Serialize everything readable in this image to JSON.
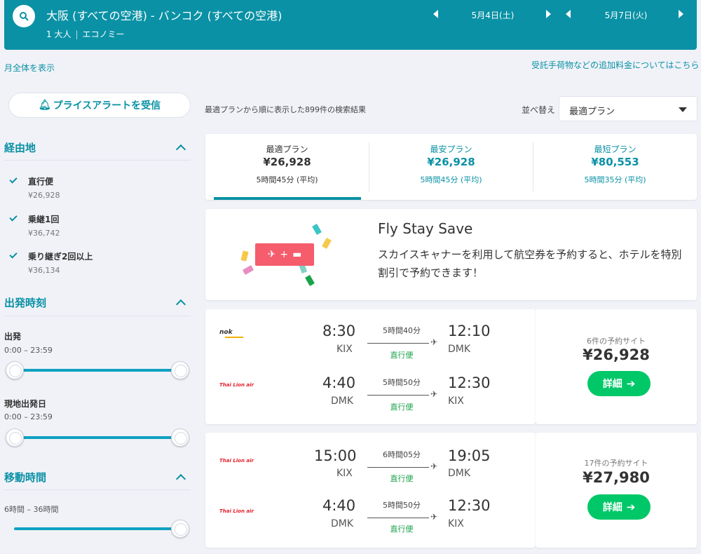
{
  "header": {
    "route": "大阪 (すべての空港) - バンコク (すべての空港)",
    "passengers": "1 大人",
    "cabin": "エコノミー",
    "depart_date": "5月4日(土)",
    "return_date": "5月7日(火)"
  },
  "links": {
    "show_month": "月全体を表示",
    "extra_fees": "受託手荷物などの追加料金についてはこちら"
  },
  "sidebar": {
    "price_alert": "プライスアラートを受信",
    "stops": {
      "title": "経由地",
      "options": [
        {
          "label": "直行便",
          "price": "¥26,928"
        },
        {
          "label": "乗継1回",
          "price": "¥36,742"
        },
        {
          "label": "乗り継ぎ2回以上",
          "price": "¥36,134"
        }
      ]
    },
    "departure_time": {
      "title": "出発時刻",
      "outbound_label": "出発",
      "outbound_range": "0:00 – 23:59",
      "return_label": "現地出発日",
      "return_range": "0:00 – 23:59"
    },
    "duration": {
      "title": "移動時間",
      "range": "6時間 – 36時間"
    }
  },
  "results": {
    "count_text": "最適プランから順に表示した899件の検索結果",
    "sort_label": "並べ替え",
    "sort_value": "最適プラン"
  },
  "tabs": [
    {
      "label": "最適プラン",
      "price": "¥26,928",
      "duration": "5時間45分 (平均)"
    },
    {
      "label": "最安プラン",
      "price": "¥26,928",
      "duration": "5時間45分 (平均)"
    },
    {
      "label": "最短プラン",
      "price": "¥80,553",
      "duration": "5時間35分 (平均)"
    }
  ],
  "promo": {
    "title": "Fly Stay Save",
    "text": "スカイスキャナーを利用して航空券を予約すると、ホテルを特別割引で予約できます！"
  },
  "flights": [
    {
      "legs": [
        {
          "airline": "nok",
          "dep_time": "8:30",
          "dep_ap": "KIX",
          "duration": "5時間40分",
          "stops": "直行便",
          "arr_time": "12:10",
          "arr_ap": "DMK"
        },
        {
          "airline": "Thai Lion air",
          "dep_time": "4:40",
          "dep_ap": "DMK",
          "duration": "5時間50分",
          "stops": "直行便",
          "arr_time": "12:30",
          "arr_ap": "KIX"
        }
      ],
      "sites": "6件の予約サイト",
      "price": "¥26,928",
      "button": "詳細"
    },
    {
      "legs": [
        {
          "airline": "Thai Lion air",
          "dep_time": "15:00",
          "dep_ap": "KIX",
          "duration": "6時間05分",
          "stops": "直行便",
          "arr_time": "19:05",
          "arr_ap": "DMK"
        },
        {
          "airline": "Thai Lion air",
          "dep_time": "4:40",
          "dep_ap": "DMK",
          "duration": "5時間50分",
          "stops": "直行便",
          "arr_time": "12:30",
          "arr_ap": "KIX"
        }
      ],
      "sites": "17件の予約サイト",
      "price": "¥27,980",
      "button": "詳細"
    }
  ]
}
